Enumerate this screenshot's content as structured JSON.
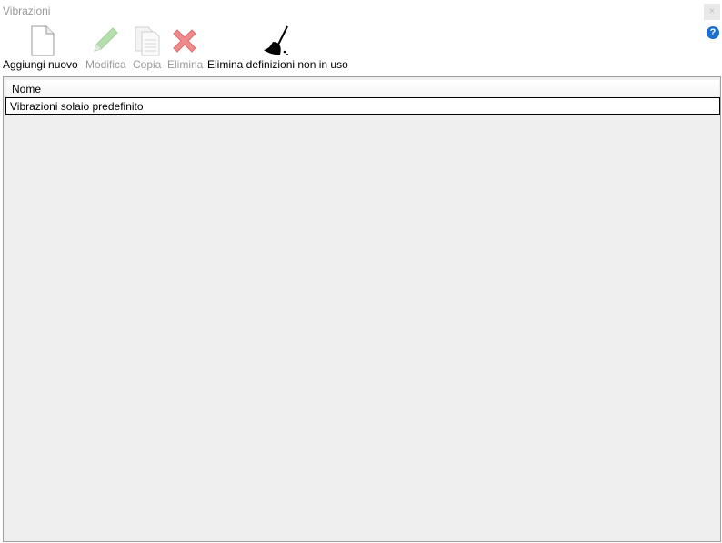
{
  "window": {
    "title": "Vibrazioni",
    "close_glyph": "×",
    "help_glyph": "?"
  },
  "toolbar": {
    "add": "Aggiungi nuovo",
    "edit": "Modifica",
    "copy": "Copia",
    "delete": "Elimina",
    "purge": "Elimina definizioni non in uso"
  },
  "table": {
    "columns": [
      "Nome"
    ],
    "rows": [
      {
        "name": "Vibrazioni solaio predefinito"
      }
    ]
  },
  "colors": {
    "disabled_text": "#9a9a9a",
    "delete_red": "#e86a6a",
    "help_blue": "#1b6fd0"
  }
}
